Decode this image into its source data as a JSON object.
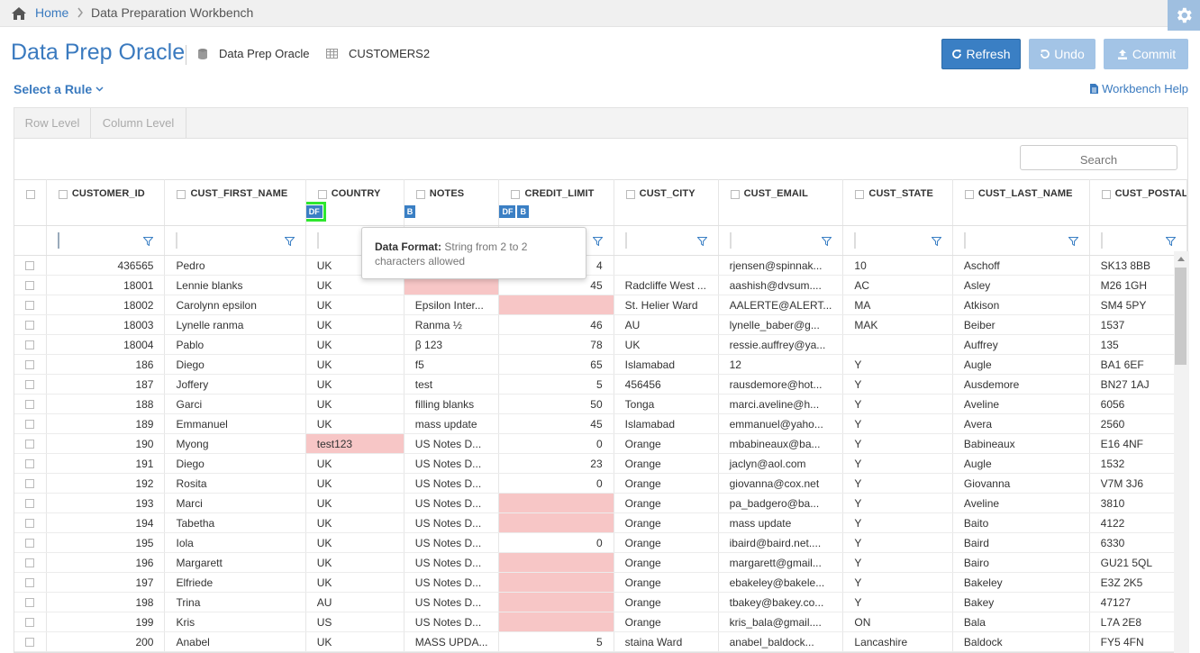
{
  "breadcrumb": {
    "home": "Home",
    "current": "Data Preparation Workbench"
  },
  "title": "Data Prep Oracle",
  "datasource": {
    "connection": "Data Prep Oracle",
    "table": "CUSTOMERS2"
  },
  "actions": {
    "refresh": "Refresh",
    "undo": "Undo",
    "commit": "Commit"
  },
  "rule_select": "Select a Rule",
  "help": "Workbench Help",
  "tabs": [
    {
      "label": "Row Level"
    },
    {
      "label": "Column Level"
    }
  ],
  "search": {
    "placeholder": "Search"
  },
  "columns": [
    {
      "name": "CUSTOMER_ID",
      "badges": ""
    },
    {
      "name": "CUST_FIRST_NAME",
      "badges": ""
    },
    {
      "name": "COUNTRY",
      "badges": "DF"
    },
    {
      "name": "NOTES",
      "badges": "B"
    },
    {
      "name": "CREDIT_LIMIT",
      "badges": "DF B"
    },
    {
      "name": "CUST_CITY",
      "badges": ""
    },
    {
      "name": "CUST_EMAIL",
      "badges": ""
    },
    {
      "name": "CUST_STATE",
      "badges": ""
    },
    {
      "name": "CUST_LAST_NAME",
      "badges": ""
    },
    {
      "name": "CUST_POSTAL_",
      "badges": ""
    }
  ],
  "tooltip": {
    "label": "Data Format:",
    "text": "String from 2 to 2 characters allowed"
  },
  "rows": [
    [
      "436565",
      "Pedro",
      "UK",
      "",
      "4",
      "",
      "rjensen@spinnak...",
      "10",
      "Aschoff",
      "SK13 8BB"
    ],
    [
      "18001",
      "Lennie blanks",
      "UK",
      "",
      "45",
      "Radcliffe West ...",
      "aashish@dvsum....",
      "AC",
      "Asley",
      "M26 1GH"
    ],
    [
      "18002",
      "Carolynn epsilon",
      "UK",
      "Epsilon Inter...",
      "",
      "St. Helier Ward",
      "AALERTE@ALERT...",
      "MA",
      "Atkison",
      "SM4 5PY"
    ],
    [
      "18003",
      "Lynelle ranma",
      "UK",
      "Ranma ½",
      "46",
      "AU",
      "lynelle_baber@g...",
      "MAK",
      "Beiber",
      "1537"
    ],
    [
      "18004",
      "Pablo",
      "UK",
      "β 123",
      "78",
      "UK",
      "ressie.auffrey@ya...",
      "",
      "Auffrey",
      "135"
    ],
    [
      "186",
      "Diego",
      "UK",
      "f5",
      "65",
      "Islamabad",
      "12",
      "Y",
      "Augle",
      "BA1 6EF"
    ],
    [
      "187",
      "Joffery",
      "UK",
      "test",
      "5",
      "456456",
      "rausdemore@hot...",
      "Y",
      "Ausdemore",
      "BN27 1AJ"
    ],
    [
      "188",
      "Garci",
      "UK",
      "filling blanks",
      "50",
      "Tonga",
      "marci.aveline@h...",
      "Y",
      "Aveline",
      "6056"
    ],
    [
      "189",
      "Emmanuel",
      "UK",
      "mass update",
      "45",
      "Islamabad",
      "emmanuel@yaho...",
      "Y",
      "Avera",
      "2560"
    ],
    [
      "190",
      "Myong",
      "test123",
      "US Notes D...",
      "0",
      "Orange",
      "mbabineaux@ba...",
      "Y",
      "Babineaux",
      "E16 4NF"
    ],
    [
      "191",
      "Diego",
      "UK",
      "US Notes D...",
      "23",
      "Orange",
      "jaclyn@aol.com",
      "Y",
      "Augle",
      "1532"
    ],
    [
      "192",
      "Rosita",
      "UK",
      "US Notes D...",
      "0",
      "Orange",
      "giovanna@cox.net",
      "Y",
      "Giovanna",
      "V7M 3J6"
    ],
    [
      "193",
      "Marci",
      "UK",
      "US Notes D...",
      "",
      "Orange",
      "pa_badgero@ba...",
      "Y",
      "Aveline",
      "3810"
    ],
    [
      "194",
      "Tabetha",
      "UK",
      "US Notes D...",
      "",
      "Orange",
      "mass update",
      "Y",
      "Baito",
      "4122"
    ],
    [
      "195",
      "Iola",
      "UK",
      "US Notes D...",
      "0",
      "Orange",
      "ibaird@baird.net....",
      "Y",
      "Baird",
      "6330"
    ],
    [
      "196",
      "Margarett",
      "UK",
      "US Notes D...",
      "",
      "Orange",
      "margarett@gmail...",
      "Y",
      "Bairo",
      "GU21 5QL"
    ],
    [
      "197",
      "Elfriede",
      "UK",
      "US Notes D...",
      "",
      "Orange",
      "ebakeley@bakele...",
      "Y",
      "Bakeley",
      "E3Z 2K5"
    ],
    [
      "198",
      "Trina",
      "AU",
      "US Notes D...",
      "",
      "Orange",
      "tbakey@bakey.co...",
      "Y",
      "Bakey",
      "47127"
    ],
    [
      "199",
      "Kris",
      "US",
      "US Notes D...",
      "",
      "Orange",
      "kris_bala@gmail....",
      "ON",
      "Bala",
      "L7A 2E8"
    ],
    [
      "200",
      "Anabel",
      "UK",
      "MASS UPDA...",
      "5",
      "staina Ward",
      "anabel_baldock...",
      "Lancashire",
      "Baldock",
      "FY5 4FN"
    ]
  ],
  "error_cells": [
    [
      1,
      3
    ],
    [
      2,
      4
    ],
    [
      9,
      2
    ],
    [
      12,
      4
    ],
    [
      13,
      4
    ],
    [
      15,
      4
    ],
    [
      16,
      4
    ],
    [
      17,
      4
    ],
    [
      18,
      4
    ]
  ],
  "colors": {
    "accent": "#3a7abf",
    "button": "#3a7fc4",
    "button_disabled": "#a3c4e6",
    "error_cell": "#f7c6c6",
    "highlight": "#2ee62e"
  }
}
